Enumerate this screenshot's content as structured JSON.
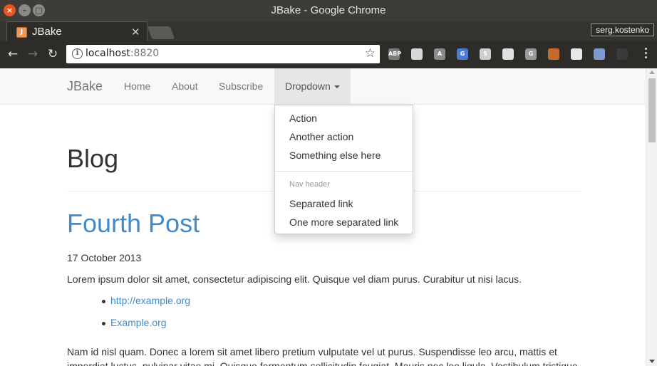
{
  "window": {
    "title": "JBake - Google Chrome"
  },
  "tabs": [
    {
      "label": "JBake",
      "favicon": "J"
    }
  ],
  "profile": {
    "name": "serg.kostenko"
  },
  "toolbar": {
    "url_host": "localhost",
    "url_port": ":8820"
  },
  "extensions": [
    {
      "name": "adblock-icon",
      "label": "ABP",
      "color": "#7a7a7a"
    },
    {
      "name": "cube-icon",
      "label": "",
      "color": "#d8d8d8"
    },
    {
      "name": "angular-icon",
      "label": "A",
      "color": "#8c8c8c"
    },
    {
      "name": "translate-icon",
      "label": "G",
      "color": "#4a7bd8"
    },
    {
      "name": "s-extension-icon",
      "label": "S",
      "color": "#cfcfcf"
    },
    {
      "name": "shield-icon",
      "label": "",
      "color": "#e0e0e0"
    },
    {
      "name": "g-extension-icon",
      "label": "G",
      "color": "#9a9a9a"
    },
    {
      "name": "owl-icon",
      "label": "",
      "color": "#c46a2e"
    },
    {
      "name": "gnome-icon",
      "label": "",
      "color": "#e8e8e8"
    },
    {
      "name": "key-icon",
      "label": "",
      "color": "#7a9ad0"
    },
    {
      "name": "flag-icon",
      "label": "",
      "color": "#3a3a3a"
    }
  ],
  "navbar": {
    "brand": "JBake",
    "links": {
      "home": "Home",
      "about": "About",
      "subscribe": "Subscribe"
    },
    "dropdown": {
      "label": "Dropdown",
      "items": [
        "Action",
        "Another action",
        "Something else here"
      ],
      "header": "Nav header",
      "separated": [
        "Separated link",
        "One more separated link"
      ]
    }
  },
  "main": {
    "title": "Blog",
    "post": {
      "title": "Fourth Post",
      "date": "17 October 2013",
      "intro": "Lorem ipsum dolor sit amet, consectetur adipiscing elit. Quisque vel diam purus. Curabitur ut nisi lacus.",
      "links": [
        "http://example.org",
        "Example.org"
      ],
      "body": "Nam id nisl quam. Donec a lorem sit amet libero pretium vulputate vel ut purus. Suspendisse leo arcu, mattis et imperdiet luctus, pulvinar vitae mi. Quisque fermentum sollicitudin feugiat. Mauris nec leo ligula. Vestibulum tristique"
    }
  }
}
